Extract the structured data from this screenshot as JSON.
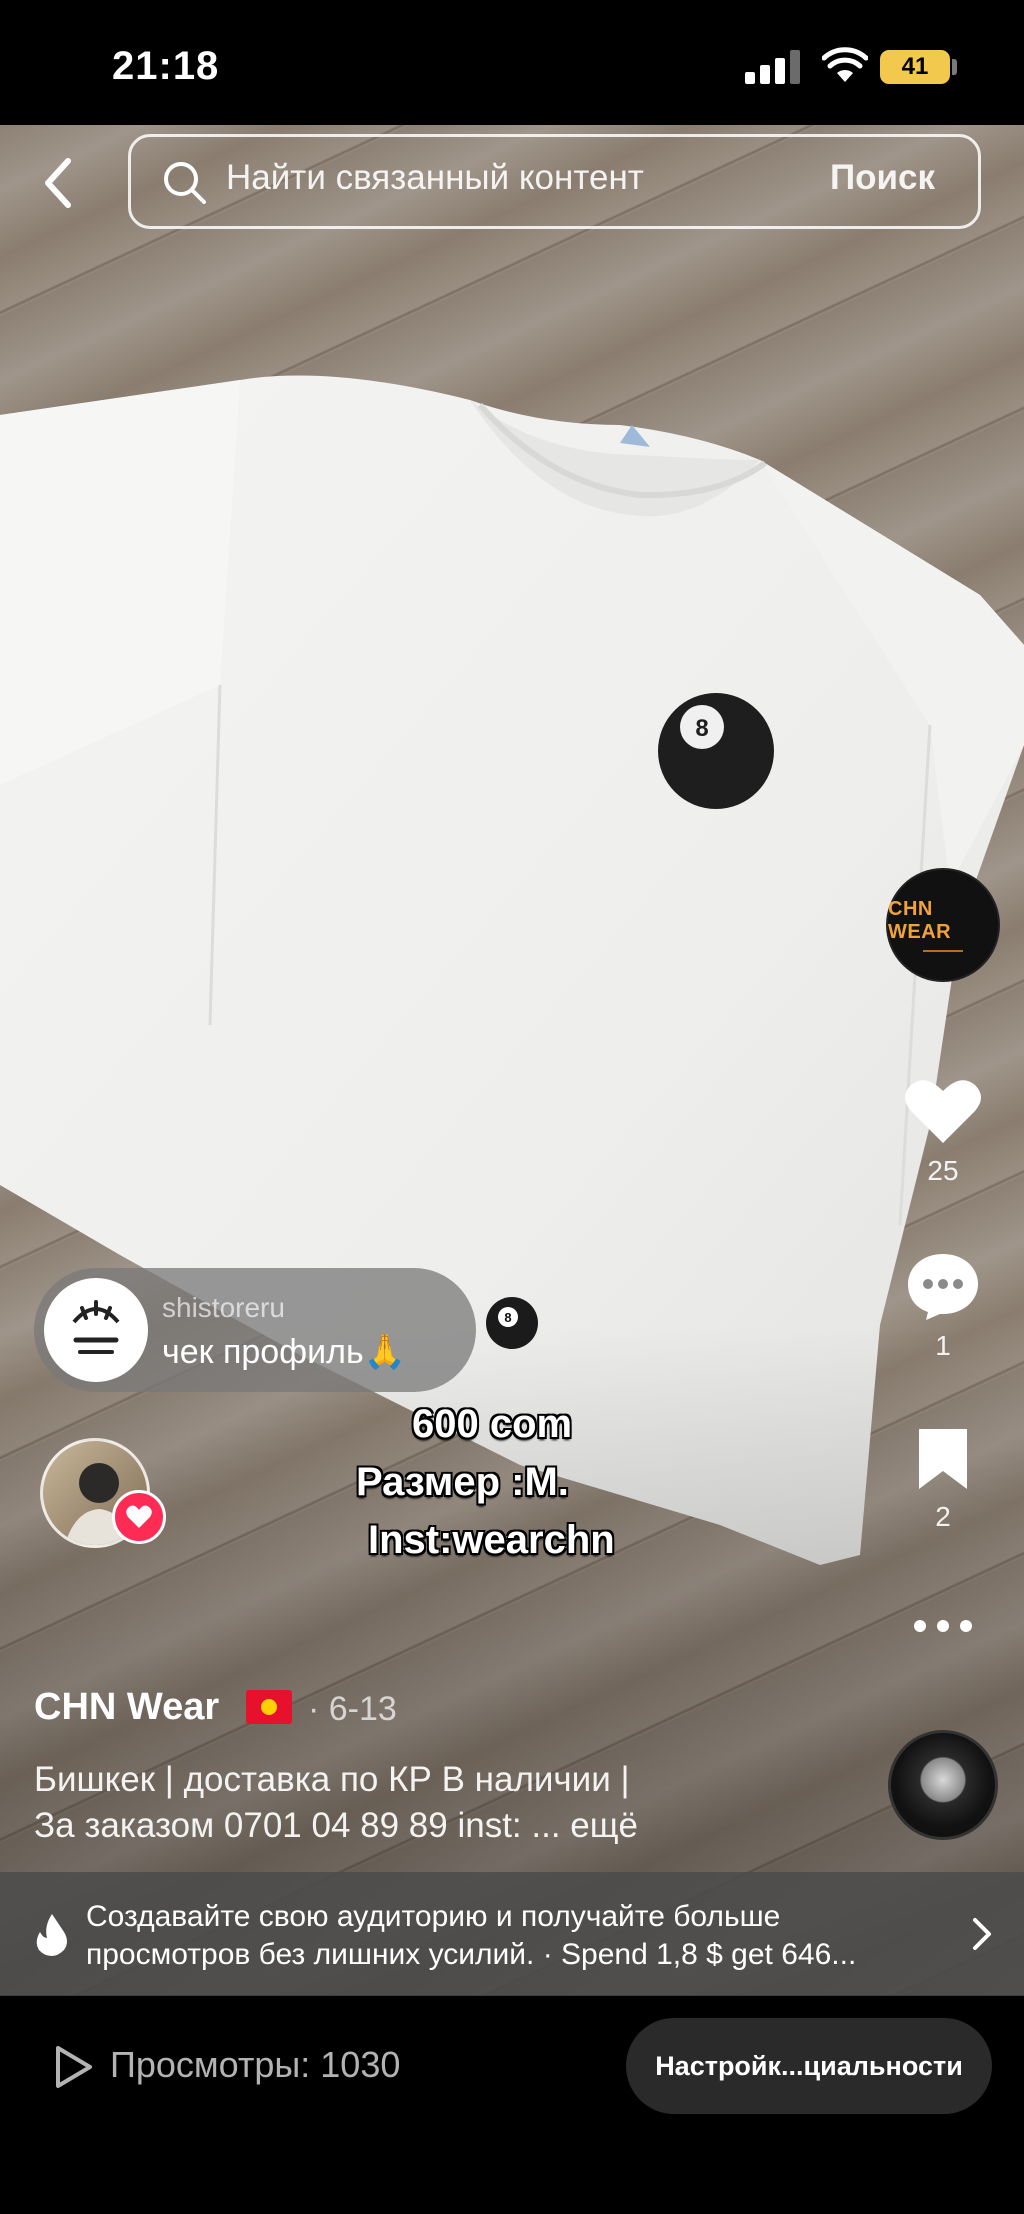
{
  "status_bar": {
    "time": "21:18",
    "battery": "41"
  },
  "search": {
    "placeholder": "Найти связанный контент",
    "submit_label": "Поиск"
  },
  "rail": {
    "brand_avatar_text": "CHN WEAR",
    "likes": "25",
    "comments": "1",
    "saves": "2"
  },
  "comment": {
    "username": "shistoreru",
    "text": "чек профиль🙏"
  },
  "overlay": {
    "line1": "600 com",
    "line2": "Размер :M.",
    "line3": "Inst:wearchn"
  },
  "post": {
    "author": "CHN Wear",
    "date": "· 6-13",
    "caption_line1": "Бишкек | доставка по КР В наличии |",
    "caption_line2": "За заказом 0701 04 89 89 inst: ... ещё"
  },
  "promo": {
    "line1": "Создавайте свою аудиторию и получайте больше",
    "line2": "просмотров без лишних усилий. · Spend 1,8 $ get 646..."
  },
  "bottom": {
    "views": "Просмотры: 1030",
    "privacy_button": "Настройк...циальности"
  },
  "colors": {
    "accent_red": "#fe2c55",
    "battery": "#f2c94c",
    "brand_orange": "#f2a23a"
  }
}
